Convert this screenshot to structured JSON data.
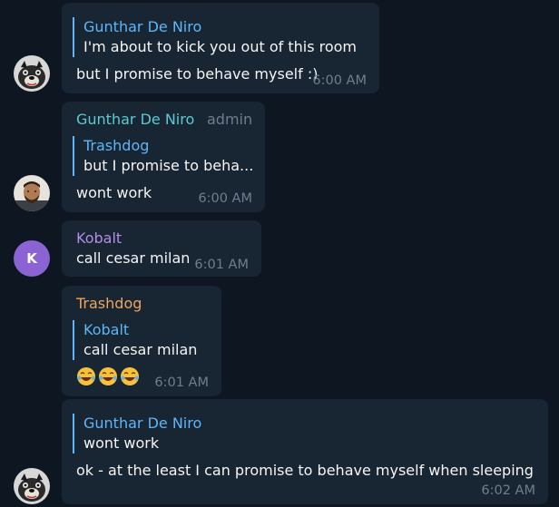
{
  "messages": [
    {
      "reply_name": "Gunthar De Niro",
      "reply_text": "I'm about to kick you out of this room",
      "text": "but I promise to behave myself :)",
      "time": "6:00 AM"
    },
    {
      "sender": "Gunthar De Niro",
      "sender_color": "#5fc9d3",
      "role": "admin",
      "reply_name": "Trashdog",
      "reply_text": "but I promise to beha...",
      "text": "wont work",
      "time": "6:00 AM"
    },
    {
      "sender": "Kobalt",
      "sender_color": "#b18ee8",
      "avatar_letter": "K",
      "avatar_color": "#8c63d2",
      "text": "call cesar milan",
      "time": "6:01 AM"
    },
    {
      "sender": "Trashdog",
      "sender_color": "#f0a35c",
      "reply_name": "Kobalt",
      "reply_text": "call cesar milan",
      "emoji_names": [
        "tears-of-joy-emoji",
        "tears-of-joy-emoji",
        "tears-of-joy-emoji"
      ],
      "time": "6:01 AM"
    },
    {
      "reply_name": "Gunthar De Niro",
      "reply_text": "wont work",
      "text": "ok - at the least I can promise to behave myself when sleeping",
      "time": "6:02 AM"
    }
  ],
  "colors": {
    "background": "#0e1621",
    "bubble": "#182533",
    "reply_accent": "#5eb5f7",
    "timestamp": "#6d7f8f"
  }
}
